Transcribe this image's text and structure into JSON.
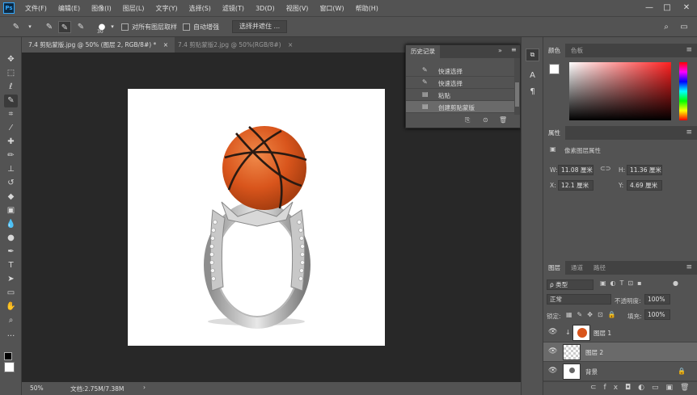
{
  "app": {
    "logo": "Ps"
  },
  "menu": [
    "文件(F)",
    "编辑(E)",
    "图像(I)",
    "图层(L)",
    "文字(Y)",
    "选择(S)",
    "滤镜(T)",
    "3D(D)",
    "视图(V)",
    "窗口(W)",
    "帮助(H)"
  ],
  "window_controls": {
    "minimize": "—",
    "maximize": "□",
    "close": "✕"
  },
  "options": {
    "brush_size": "30",
    "sample_all_layers": "对所有图层取样",
    "auto_enhance": "自动增强",
    "select_and_mask": "选择并遮住 ..."
  },
  "tabs": [
    {
      "label": "7.4 剪贴蒙版.jpg @ 50% (图层 2, RGB/8#) *",
      "close": "×"
    },
    {
      "label": "7.4 剪贴蒙版2.jpg @ 50%(RGB/8#)",
      "close": "×"
    }
  ],
  "status": {
    "zoom": "50%",
    "doc": "文档:2.75M/7.38M",
    "arrow": "›"
  },
  "history": {
    "title": "历史记录",
    "items": [
      "快速选择",
      "快速选择",
      "粘贴",
      "创建剪贴蒙版"
    ]
  },
  "color_panel": {
    "tabs": [
      "颜色",
      "色板"
    ]
  },
  "properties": {
    "title": "属性",
    "subtitle": "像素图层属性",
    "w_label": "W:",
    "w": "11.08 厘米",
    "h_label": "H:",
    "h": "11.36 厘米",
    "x_label": "X:",
    "x": "12.1 厘米",
    "y_label": "Y:",
    "y": "4.69 厘米"
  },
  "layers_panel": {
    "tabs": [
      "图层",
      "通道",
      "路径"
    ],
    "filter": "ρ 类型",
    "blend_mode": "正常",
    "opacity_label": "不透明度:",
    "opacity": "100%",
    "lock_label": "锁定:",
    "fill_label": "填充:",
    "fill": "100%",
    "layers": [
      "图层 1",
      "图层 2",
      "背景"
    ]
  }
}
